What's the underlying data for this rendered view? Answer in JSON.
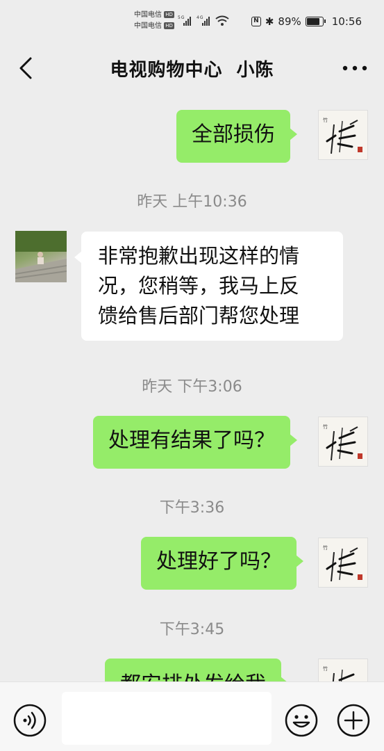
{
  "status_bar": {
    "carrier1": "中国电信",
    "carrier2": "中国电信",
    "hd_badge": "HD",
    "net1": "5G",
    "net2": "4G",
    "battery_pct": "89%",
    "battery_level": 0.89,
    "time": "10:56",
    "icons": [
      "nfc-icon",
      "bluetooth-icon",
      "wifi-icon",
      "signal-icon",
      "battery-icon"
    ]
  },
  "header": {
    "title": "电视购物中心  小陈"
  },
  "messages": [
    {
      "type": "out",
      "text": "全部损伤"
    },
    {
      "type": "time",
      "text": "昨天 上午10:36"
    },
    {
      "type": "in",
      "lines": [
        "非常抱歉出现这样的情",
        "况，您稍等，我马上反",
        "馈给售后部门帮您处理"
      ]
    },
    {
      "type": "time",
      "text": "昨天 下午3:06"
    },
    {
      "type": "out",
      "text": "处理有结果了吗？"
    },
    {
      "type": "time",
      "text": "下午3:36"
    },
    {
      "type": "out",
      "text": "处理好了吗？"
    },
    {
      "type": "time",
      "text": "下午3:45"
    },
    {
      "type": "out",
      "text": "都安排处发给我"
    }
  ],
  "input_bar": {
    "value": "",
    "icons": [
      "voice-icon",
      "emoji-icon",
      "plus-icon"
    ]
  },
  "colors": {
    "background": "#ededed",
    "outgoing_bubble": "#95ec69",
    "incoming_bubble": "#ffffff",
    "timestamp": "#8a8a8a"
  }
}
